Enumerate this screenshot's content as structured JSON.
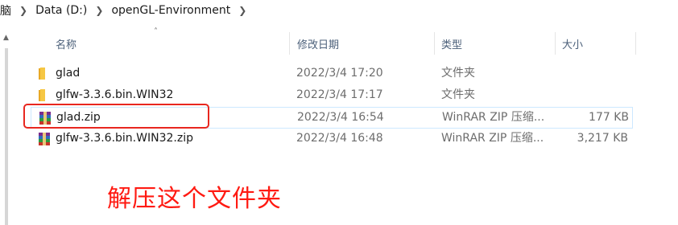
{
  "breadcrumb": {
    "items": [
      "脑",
      "Data (D:)",
      "openGL-Environment"
    ]
  },
  "columns": {
    "name": "名称",
    "date": "修改日期",
    "type": "类型",
    "size": "大小"
  },
  "files": [
    {
      "name": "glad",
      "date": "2022/3/4 17:20",
      "type": "文件夹",
      "size": "",
      "icon": "folder-icon"
    },
    {
      "name": "glfw-3.3.6.bin.WIN32",
      "date": "2022/3/4 17:17",
      "type": "文件夹",
      "size": "",
      "icon": "folder-icon"
    },
    {
      "name": "glad.zip",
      "date": "2022/3/4 16:54",
      "type": "WinRAR ZIP 压缩...",
      "size": "177 KB",
      "icon": "winrar-archive-icon"
    },
    {
      "name": "glfw-3.3.6.bin.WIN32.zip",
      "date": "2022/3/4 16:48",
      "type": "WinRAR ZIP 压缩...",
      "size": "3,217 KB",
      "icon": "winrar-archive-icon"
    }
  ],
  "annotation": {
    "text": "解压这个文件夹",
    "color": "#ff1a12"
  },
  "colors": {
    "folder": "#f6c744",
    "highlight": "#e8271f",
    "selection_border": "#cde8ff",
    "header_text": "#4c607a"
  }
}
